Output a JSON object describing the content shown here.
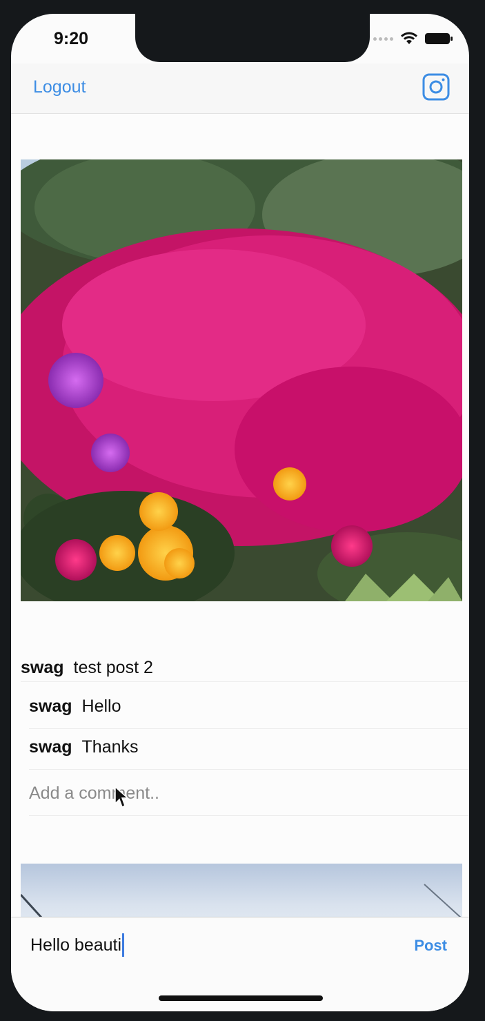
{
  "status_bar": {
    "time": "9:20"
  },
  "nav": {
    "logout_label": "Logout",
    "camera_icon": "instagram-camera-icon"
  },
  "post": {
    "username": "swag",
    "caption": "test post 2",
    "comments": [
      {
        "username": "swag",
        "text": "Hello"
      },
      {
        "username": "swag",
        "text": "Thanks"
      }
    ],
    "add_comment_placeholder": "Add a comment.."
  },
  "composer": {
    "value": "Hello beauti",
    "post_label": "Post"
  },
  "colors": {
    "accent": "#3d8de4",
    "caret": "#3d7be0"
  }
}
